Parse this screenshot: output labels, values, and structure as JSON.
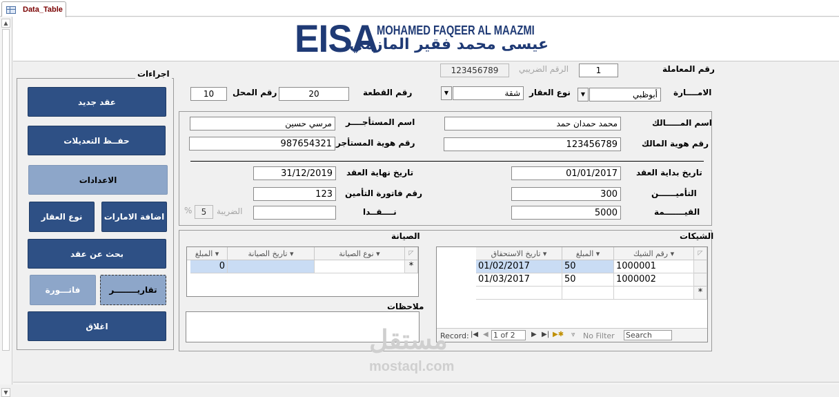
{
  "tab": {
    "label": "Data_Table",
    "icon": "form-icon"
  },
  "logo": {
    "big": "EISA",
    "english": "MOHAMED FAQEER AL MAAZMI",
    "arabic": "عيسى محمد فقير المازمي"
  },
  "actions": {
    "title": "اجراءات",
    "new_contract": "عقد جديد",
    "save_changes": "حفــظ  التعديلات",
    "settings": "الاعدادات",
    "add_emirates": "اضافة الامارات",
    "property_type": "نوع العقار",
    "search_contract": "بحث عن عقد",
    "reports": "تقاريــــــــر",
    "invoice": "فاتـــورة",
    "close": "اغلاق"
  },
  "form": {
    "transaction_no_label": "رقم المعاملة",
    "transaction_no": "1",
    "tax_no_label": "الرقم الضريبي",
    "tax_no": "123456789",
    "emirate_label": "الامــــارة",
    "emirate": "أبوظبي",
    "property_type_label": "نوع العقار",
    "property_type": "شقة",
    "plot_no_label": "رقم القطعة",
    "plot_no": "20",
    "shop_no_label": "رقم المحل",
    "shop_no": "10",
    "owner_name_label": "اسم المـــــالك",
    "owner_name": "محمد حمدان حمد",
    "tenant_name_label": "اسم المستأجــــر",
    "tenant_name": "مرسي حسين",
    "owner_id_label": "رقم هوية المالك",
    "owner_id": "123456789",
    "tenant_id_label": "رقم هوية المستأجر",
    "tenant_id": "987654321",
    "start_date_label": "تاريخ بداية العقد",
    "start_date": "01/01/2017",
    "end_date_label": "تاريخ نهاية العقد",
    "end_date": "31/12/2019",
    "insurance_label": "التأميــــــن",
    "insurance": "300",
    "insurance_invoice_label": "رقم فاتورة التأمين",
    "insurance_invoice": "123",
    "value_label": "القيـــــــمة",
    "value": "5000",
    "cash_label": "نــــقــدا",
    "cash": "",
    "tax_label": "الضريبة",
    "tax": "5",
    "tax_unit": "%"
  },
  "cheques": {
    "title": "الشيكات",
    "headers": [
      "رقم الشيك",
      "المبلغ",
      "تاريخ الاستحقاق"
    ],
    "rows": [
      {
        "cheque_no": "1000001",
        "amount": "50",
        "due_date": "01/02/2017"
      },
      {
        "cheque_no": "1000002",
        "amount": "50",
        "due_date": "01/03/2017"
      }
    ],
    "new_row_marker": "*",
    "nav": {
      "record_label": "Record:",
      "position": "1 of 2",
      "filter": "No Filter",
      "search": "Search"
    }
  },
  "maintenance": {
    "title": "الصيانة",
    "headers": [
      "نوع الصيانة",
      "تاريخ الصيانة",
      "المبلغ"
    ],
    "row": {
      "type": "",
      "date": "",
      "amount": "0"
    },
    "new_row_marker": "*"
  },
  "notes": {
    "title": "ملاحظات",
    "value": ""
  },
  "watermark": {
    "arabic": "مستقل",
    "latin": "mostaql.com"
  },
  "colors": {
    "button_dark": "#2e5085",
    "button_light": "#8da6c9",
    "logo": "#1f3a75",
    "highlight": "#c9dcf4"
  }
}
